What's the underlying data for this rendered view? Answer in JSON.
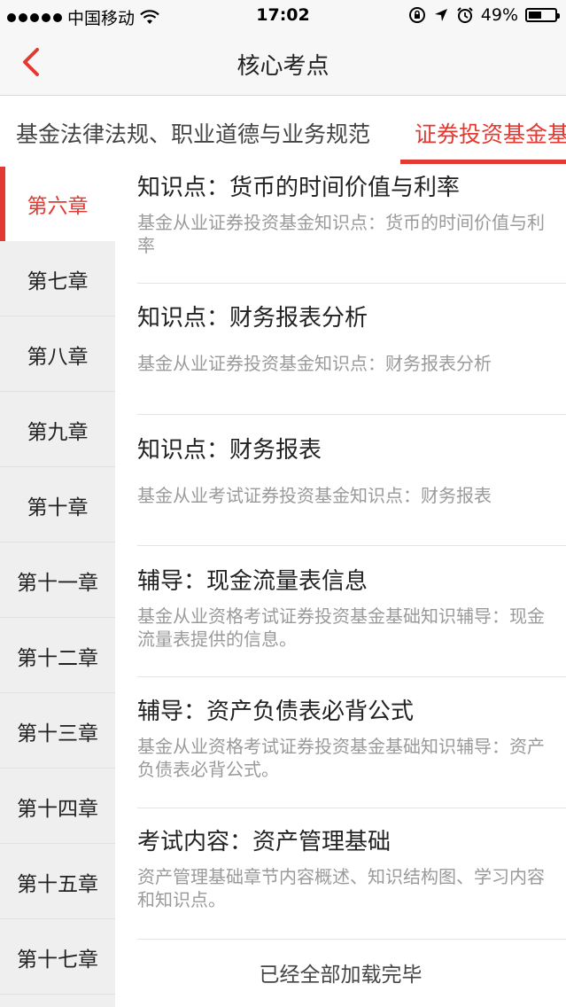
{
  "status_bar": {
    "carrier": "中国移动",
    "time": "17:02",
    "battery": "49%",
    "battery_level": 0.49,
    "signal_icon": "signal-dots-icon",
    "wifi_icon": "wifi-icon",
    "location_icon": "location-arrow-icon",
    "alarm_icon": "alarm-icon",
    "rotation_lock_icon": "rotation-lock-icon"
  },
  "nav": {
    "title": "核心考点",
    "back_icon": "chevron-left-icon"
  },
  "tabs": [
    {
      "label": "基金法律法规、职业道德与业务规范",
      "active": false
    },
    {
      "label": "证券投资基金基",
      "active": true
    }
  ],
  "sidebar": {
    "items": [
      {
        "label": "第六章",
        "active": true
      },
      {
        "label": "第七章"
      },
      {
        "label": "第八章"
      },
      {
        "label": "第九章"
      },
      {
        "label": "第十章"
      },
      {
        "label": "第十一章"
      },
      {
        "label": "第十二章"
      },
      {
        "label": "第十三章"
      },
      {
        "label": "第十四章"
      },
      {
        "label": "第十五章"
      },
      {
        "label": "第十七章"
      }
    ]
  },
  "list": {
    "items": [
      {
        "title": "知识点：货币的时间价值与利率",
        "desc": "基金从业证券投资基金知识点：货币的时间价值与利率"
      },
      {
        "title": "知识点：财务报表分析",
        "desc": "基金从业证券投资基金知识点：财务报表分析"
      },
      {
        "title": "知识点：财务报表",
        "desc": "基金从业考试证券投资基金知识点：财务报表"
      },
      {
        "title": "辅导：现金流量表信息",
        "desc": "基金从业资格考试证券投资基金基础知识辅导：现金流量表提供的信息。"
      },
      {
        "title": "辅导：资产负债表必背公式",
        "desc": "基金从业资格考试证券投资基金基础知识辅导：资产负债表必背公式。"
      },
      {
        "title": "考试内容：资产管理基础",
        "desc": "资产管理基础章节内容概述、知识结构图、学习内容和知识点。"
      }
    ],
    "footer": "已经全部加载完毕"
  },
  "colors": {
    "accent": "#e23a33",
    "sidebar_bg": "#efefef",
    "muted_text": "#9a9a9a"
  }
}
